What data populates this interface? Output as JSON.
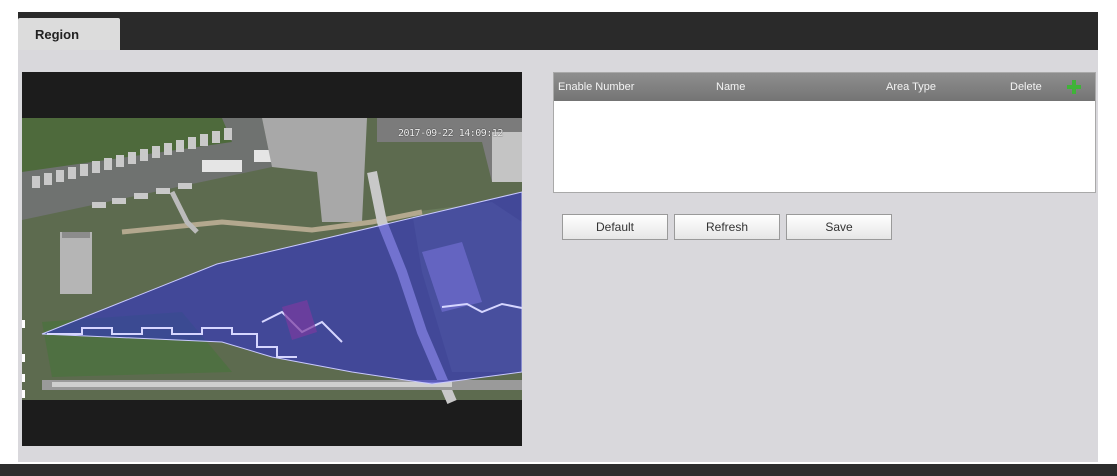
{
  "tabs": {
    "region_label": "Region"
  },
  "video": {
    "timestamp": "2017-09-22 14:09:12"
  },
  "region_table": {
    "columns": {
      "enable_number": "Enable Number",
      "name": "Name",
      "area_type": "Area Type",
      "delete": "Delete"
    },
    "rows": [],
    "add_icon": "plus-icon"
  },
  "buttons": {
    "default_label": "Default",
    "refresh_label": "Refresh",
    "save_label": "Save"
  },
  "colors": {
    "tab_bar": "#2a2a2a",
    "panel": "#d9d8dc",
    "region_overlay": "#2b2bd6",
    "add_icon": "#3fb338"
  }
}
